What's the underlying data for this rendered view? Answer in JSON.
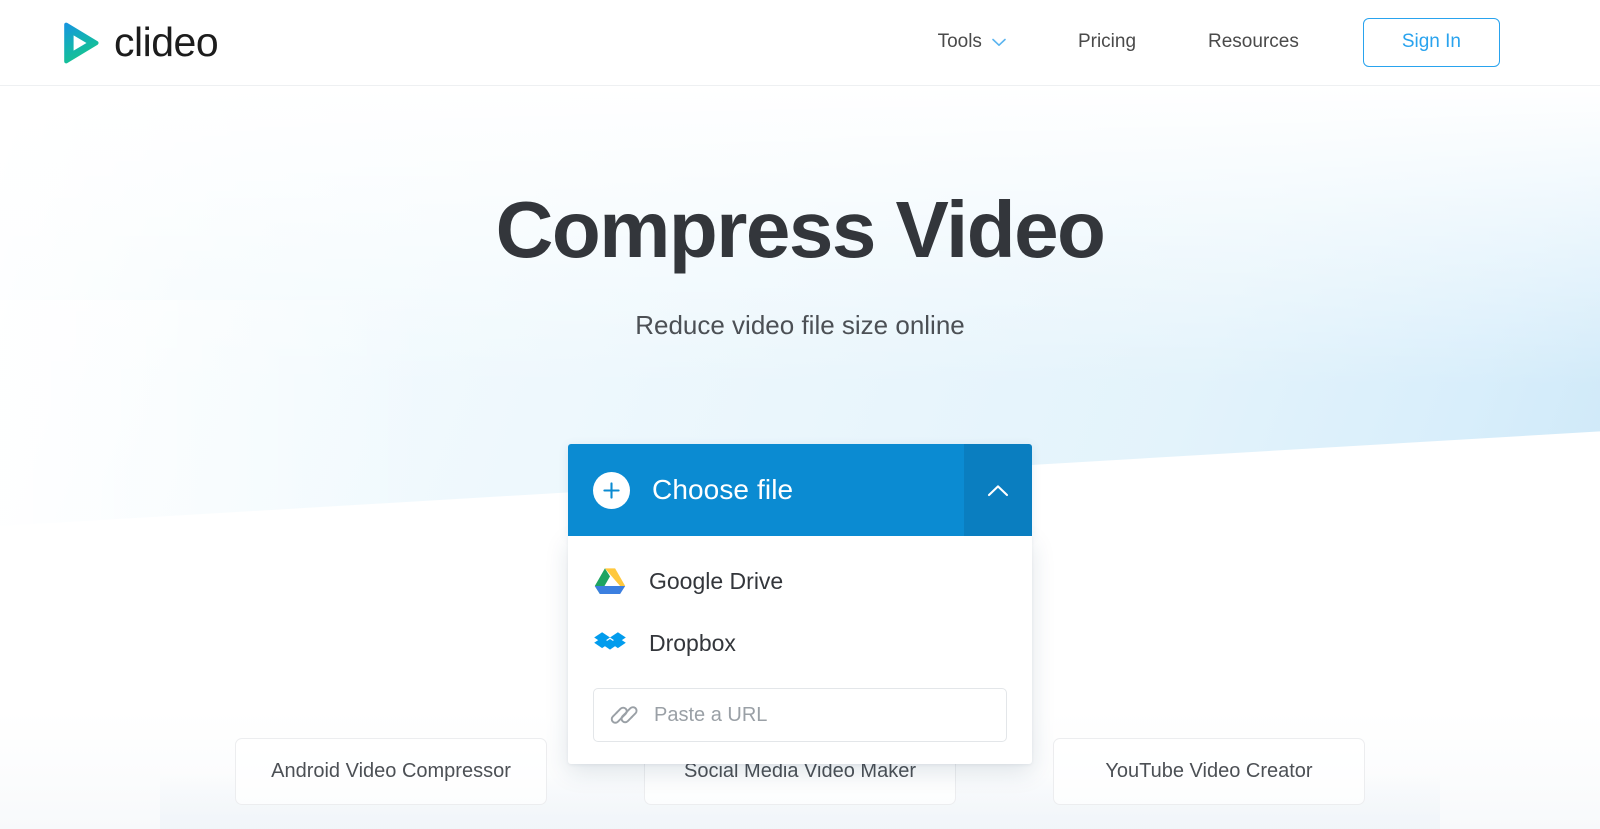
{
  "header": {
    "logo": {
      "name": "clideo",
      "icon": "play-triangle-icon",
      "gradient_start": "#1b9bd8",
      "gradient_end": "#19c78a"
    },
    "nav": [
      {
        "label": "Tools",
        "icon": "chevron-down-icon",
        "has_dropdown": true
      },
      {
        "label": "Pricing",
        "has_dropdown": false
      },
      {
        "label": "Resources",
        "has_dropdown": false
      }
    ],
    "sign_in_label": "Sign In",
    "sign_in_color": "#29a3ee"
  },
  "hero": {
    "title": "Compress Video",
    "subtitle": "Reduce video file size online"
  },
  "uploader": {
    "choose_file_label": "Choose file",
    "choose_file_icon": "plus-circle-icon",
    "toggle_icon": "chevron-up-icon",
    "button_color": "#0b8bd2",
    "toggle_color": "#0a7ec0",
    "expanded": true,
    "options": [
      {
        "label": "Google Drive",
        "icon": "google-drive-icon"
      },
      {
        "label": "Dropbox",
        "icon": "dropbox-icon"
      }
    ],
    "url_field": {
      "icon": "link-icon",
      "placeholder": "Paste a URL",
      "value": ""
    }
  },
  "related_tools": [
    {
      "label": "Android Video Compressor"
    },
    {
      "label": "Social Media Video Maker"
    },
    {
      "label": "YouTube Video Creator"
    }
  ]
}
